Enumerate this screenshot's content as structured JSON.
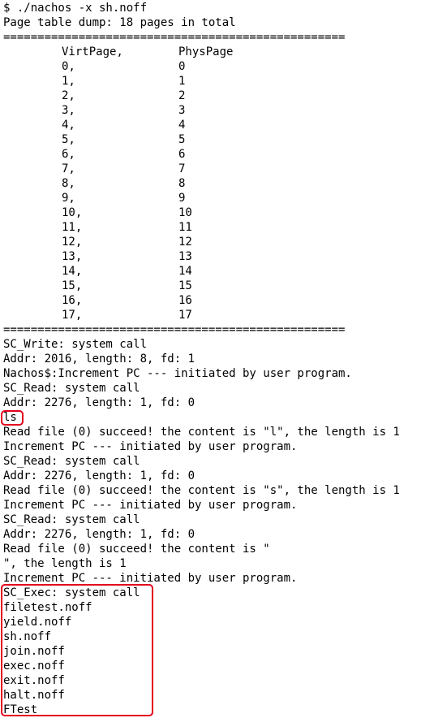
{
  "terminal": {
    "command": "$ ./nachos -x sh.noff",
    "dump_title": "Page table dump: 18 pages in total",
    "separator": "==================================================",
    "header_virt": "VirtPage,",
    "header_phys": "PhysPage",
    "page_table": [
      {
        "virt": "0,",
        "phys": "0"
      },
      {
        "virt": "1,",
        "phys": "1"
      },
      {
        "virt": "2,",
        "phys": "2"
      },
      {
        "virt": "3,",
        "phys": "3"
      },
      {
        "virt": "4,",
        "phys": "4"
      },
      {
        "virt": "5,",
        "phys": "5"
      },
      {
        "virt": "6,",
        "phys": "6"
      },
      {
        "virt": "7,",
        "phys": "7"
      },
      {
        "virt": "8,",
        "phys": "8"
      },
      {
        "virt": "9,",
        "phys": "9"
      },
      {
        "virt": "10,",
        "phys": "10"
      },
      {
        "virt": "11,",
        "phys": "11"
      },
      {
        "virt": "12,",
        "phys": "12"
      },
      {
        "virt": "13,",
        "phys": "13"
      },
      {
        "virt": "14,",
        "phys": "14"
      },
      {
        "virt": "15,",
        "phys": "15"
      },
      {
        "virt": "16,",
        "phys": "16"
      },
      {
        "virt": "17,",
        "phys": "17"
      }
    ],
    "log_lines": [
      "SC_Write: system call",
      "Addr: 2016, length: 8, fd: 1",
      "Nachos$:Increment PC --- initiated by user program.",
      "SC_Read: system call",
      "Addr: 2276, length: 1, fd: 0",
      "ls",
      "Read file (0) succeed! the content is \"l\", the length is 1",
      "Increment PC --- initiated by user program.",
      "SC_Read: system call",
      "Addr: 2276, length: 1, fd: 0",
      "Read file (0) succeed! the content is \"s\", the length is 1",
      "Increment PC --- initiated by user program.",
      "SC_Read: system call",
      "Addr: 2276, length: 1, fd: 0",
      "Read file (0) succeed! the content is \"",
      "\", the length is 1",
      "Increment PC --- initiated by user program.",
      "SC_Exec: system call",
      "filetest.noff",
      "yield.noff",
      "sh.noff",
      "join.noff",
      "exec.noff",
      "exit.noff",
      "halt.noff",
      "FTest"
    ],
    "highlight_color": "#e3001b"
  }
}
